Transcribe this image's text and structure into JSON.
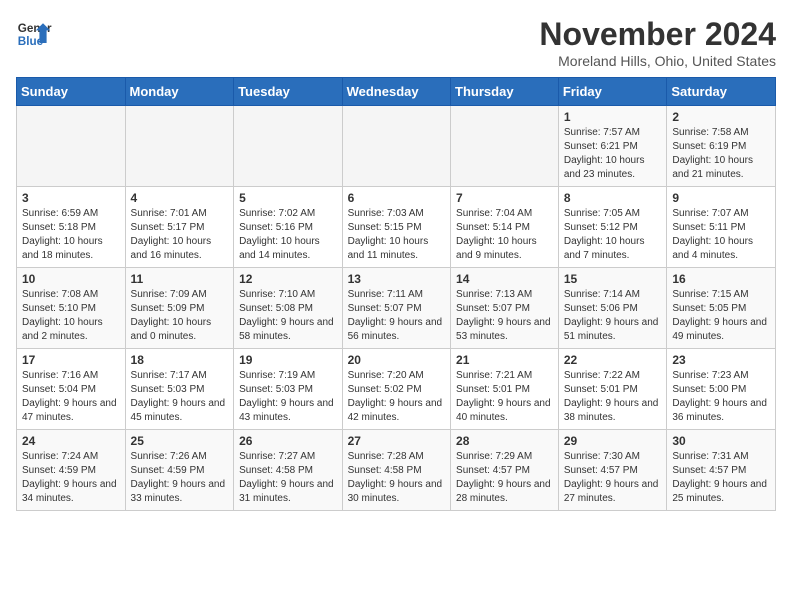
{
  "header": {
    "logo_line1": "General",
    "logo_line2": "Blue",
    "month": "November 2024",
    "location": "Moreland Hills, Ohio, United States"
  },
  "weekdays": [
    "Sunday",
    "Monday",
    "Tuesday",
    "Wednesday",
    "Thursday",
    "Friday",
    "Saturday"
  ],
  "weeks": [
    [
      {
        "day": "",
        "info": ""
      },
      {
        "day": "",
        "info": ""
      },
      {
        "day": "",
        "info": ""
      },
      {
        "day": "",
        "info": ""
      },
      {
        "day": "",
        "info": ""
      },
      {
        "day": "1",
        "info": "Sunrise: 7:57 AM\nSunset: 6:21 PM\nDaylight: 10 hours and 23 minutes."
      },
      {
        "day": "2",
        "info": "Sunrise: 7:58 AM\nSunset: 6:19 PM\nDaylight: 10 hours and 21 minutes."
      }
    ],
    [
      {
        "day": "3",
        "info": "Sunrise: 6:59 AM\nSunset: 5:18 PM\nDaylight: 10 hours and 18 minutes."
      },
      {
        "day": "4",
        "info": "Sunrise: 7:01 AM\nSunset: 5:17 PM\nDaylight: 10 hours and 16 minutes."
      },
      {
        "day": "5",
        "info": "Sunrise: 7:02 AM\nSunset: 5:16 PM\nDaylight: 10 hours and 14 minutes."
      },
      {
        "day": "6",
        "info": "Sunrise: 7:03 AM\nSunset: 5:15 PM\nDaylight: 10 hours and 11 minutes."
      },
      {
        "day": "7",
        "info": "Sunrise: 7:04 AM\nSunset: 5:14 PM\nDaylight: 10 hours and 9 minutes."
      },
      {
        "day": "8",
        "info": "Sunrise: 7:05 AM\nSunset: 5:12 PM\nDaylight: 10 hours and 7 minutes."
      },
      {
        "day": "9",
        "info": "Sunrise: 7:07 AM\nSunset: 5:11 PM\nDaylight: 10 hours and 4 minutes."
      }
    ],
    [
      {
        "day": "10",
        "info": "Sunrise: 7:08 AM\nSunset: 5:10 PM\nDaylight: 10 hours and 2 minutes."
      },
      {
        "day": "11",
        "info": "Sunrise: 7:09 AM\nSunset: 5:09 PM\nDaylight: 10 hours and 0 minutes."
      },
      {
        "day": "12",
        "info": "Sunrise: 7:10 AM\nSunset: 5:08 PM\nDaylight: 9 hours and 58 minutes."
      },
      {
        "day": "13",
        "info": "Sunrise: 7:11 AM\nSunset: 5:07 PM\nDaylight: 9 hours and 56 minutes."
      },
      {
        "day": "14",
        "info": "Sunrise: 7:13 AM\nSunset: 5:07 PM\nDaylight: 9 hours and 53 minutes."
      },
      {
        "day": "15",
        "info": "Sunrise: 7:14 AM\nSunset: 5:06 PM\nDaylight: 9 hours and 51 minutes."
      },
      {
        "day": "16",
        "info": "Sunrise: 7:15 AM\nSunset: 5:05 PM\nDaylight: 9 hours and 49 minutes."
      }
    ],
    [
      {
        "day": "17",
        "info": "Sunrise: 7:16 AM\nSunset: 5:04 PM\nDaylight: 9 hours and 47 minutes."
      },
      {
        "day": "18",
        "info": "Sunrise: 7:17 AM\nSunset: 5:03 PM\nDaylight: 9 hours and 45 minutes."
      },
      {
        "day": "19",
        "info": "Sunrise: 7:19 AM\nSunset: 5:03 PM\nDaylight: 9 hours and 43 minutes."
      },
      {
        "day": "20",
        "info": "Sunrise: 7:20 AM\nSunset: 5:02 PM\nDaylight: 9 hours and 42 minutes."
      },
      {
        "day": "21",
        "info": "Sunrise: 7:21 AM\nSunset: 5:01 PM\nDaylight: 9 hours and 40 minutes."
      },
      {
        "day": "22",
        "info": "Sunrise: 7:22 AM\nSunset: 5:01 PM\nDaylight: 9 hours and 38 minutes."
      },
      {
        "day": "23",
        "info": "Sunrise: 7:23 AM\nSunset: 5:00 PM\nDaylight: 9 hours and 36 minutes."
      }
    ],
    [
      {
        "day": "24",
        "info": "Sunrise: 7:24 AM\nSunset: 4:59 PM\nDaylight: 9 hours and 34 minutes."
      },
      {
        "day": "25",
        "info": "Sunrise: 7:26 AM\nSunset: 4:59 PM\nDaylight: 9 hours and 33 minutes."
      },
      {
        "day": "26",
        "info": "Sunrise: 7:27 AM\nSunset: 4:58 PM\nDaylight: 9 hours and 31 minutes."
      },
      {
        "day": "27",
        "info": "Sunrise: 7:28 AM\nSunset: 4:58 PM\nDaylight: 9 hours and 30 minutes."
      },
      {
        "day": "28",
        "info": "Sunrise: 7:29 AM\nSunset: 4:57 PM\nDaylight: 9 hours and 28 minutes."
      },
      {
        "day": "29",
        "info": "Sunrise: 7:30 AM\nSunset: 4:57 PM\nDaylight: 9 hours and 27 minutes."
      },
      {
        "day": "30",
        "info": "Sunrise: 7:31 AM\nSunset: 4:57 PM\nDaylight: 9 hours and 25 minutes."
      }
    ]
  ]
}
